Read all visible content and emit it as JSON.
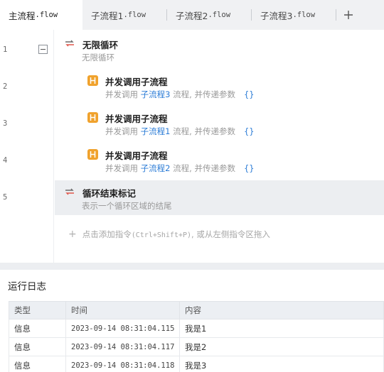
{
  "tabs": [
    {
      "prefix": "主流程",
      "suffix": ".flow"
    },
    {
      "prefix": "子流程1",
      "suffix": ".flow"
    },
    {
      "prefix": "子流程2",
      "suffix": ".flow"
    },
    {
      "prefix": "子流程3",
      "suffix": ".flow"
    }
  ],
  "tab_add_icon": "plus-icon",
  "line_numbers": [
    "1",
    "2",
    "3",
    "4",
    "5"
  ],
  "steps": [
    {
      "title": "无限循环",
      "desc": "无限循环",
      "icon": "loop-icon"
    },
    {
      "title": "并发调用子流程",
      "desc_before": "并发调用",
      "link": "子流程3",
      "desc_after": "流程, 并传递参数",
      "params": "{}",
      "icon": "subflow-icon"
    },
    {
      "title": "并发调用子流程",
      "desc_before": "并发调用",
      "link": "子流程1",
      "desc_after": "流程, 并传递参数",
      "params": "{}",
      "icon": "subflow-icon"
    },
    {
      "title": "并发调用子流程",
      "desc_before": "并发调用",
      "link": "子流程2",
      "desc_after": "流程, 并传递参数",
      "params": "{}",
      "icon": "subflow-icon"
    },
    {
      "title": "循环结束标记",
      "desc": "表示一个循环区域的结尾",
      "icon": "loop-end-icon"
    }
  ],
  "add_hint": {
    "plus": "+",
    "before": "点击添加指令",
    "shortcut": "(Ctrl+Shift+P)",
    "after": ", 或从左侧指令区拖入"
  },
  "log": {
    "title": "运行日志",
    "headers": [
      "类型",
      "时间",
      "内容"
    ],
    "rows": [
      [
        "信息",
        "2023-09-14 08:31:04.115",
        "我是1"
      ],
      [
        "信息",
        "2023-09-14 08:31:04.117",
        "我是2"
      ],
      [
        "信息",
        "2023-09-14 08:31:04.118",
        "我是3"
      ]
    ]
  },
  "colors": {
    "accent_link": "#2a7bd6",
    "subflow_icon": "#f0a22d",
    "loop_icon_red": "#e0564a",
    "loop_icon_gray": "#6c6c6c"
  }
}
